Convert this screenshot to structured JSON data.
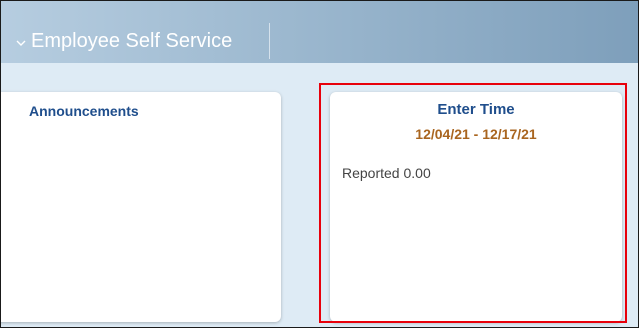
{
  "header": {
    "homepage_title": "Employee Self Service",
    "chevron_icon": "chevron-down-icon",
    "background": "#8fadc7"
  },
  "tiles": [
    {
      "title": "Announcements"
    },
    {
      "title": "Enter Time",
      "period": "12/04/21 - 12/17/21",
      "status": "Reported 0.00"
    }
  ],
  "colors": {
    "tile_title": "#1f4e8c",
    "period_text": "#a9651f",
    "highlight": "#e8000b",
    "page_background": "#deebf5"
  }
}
